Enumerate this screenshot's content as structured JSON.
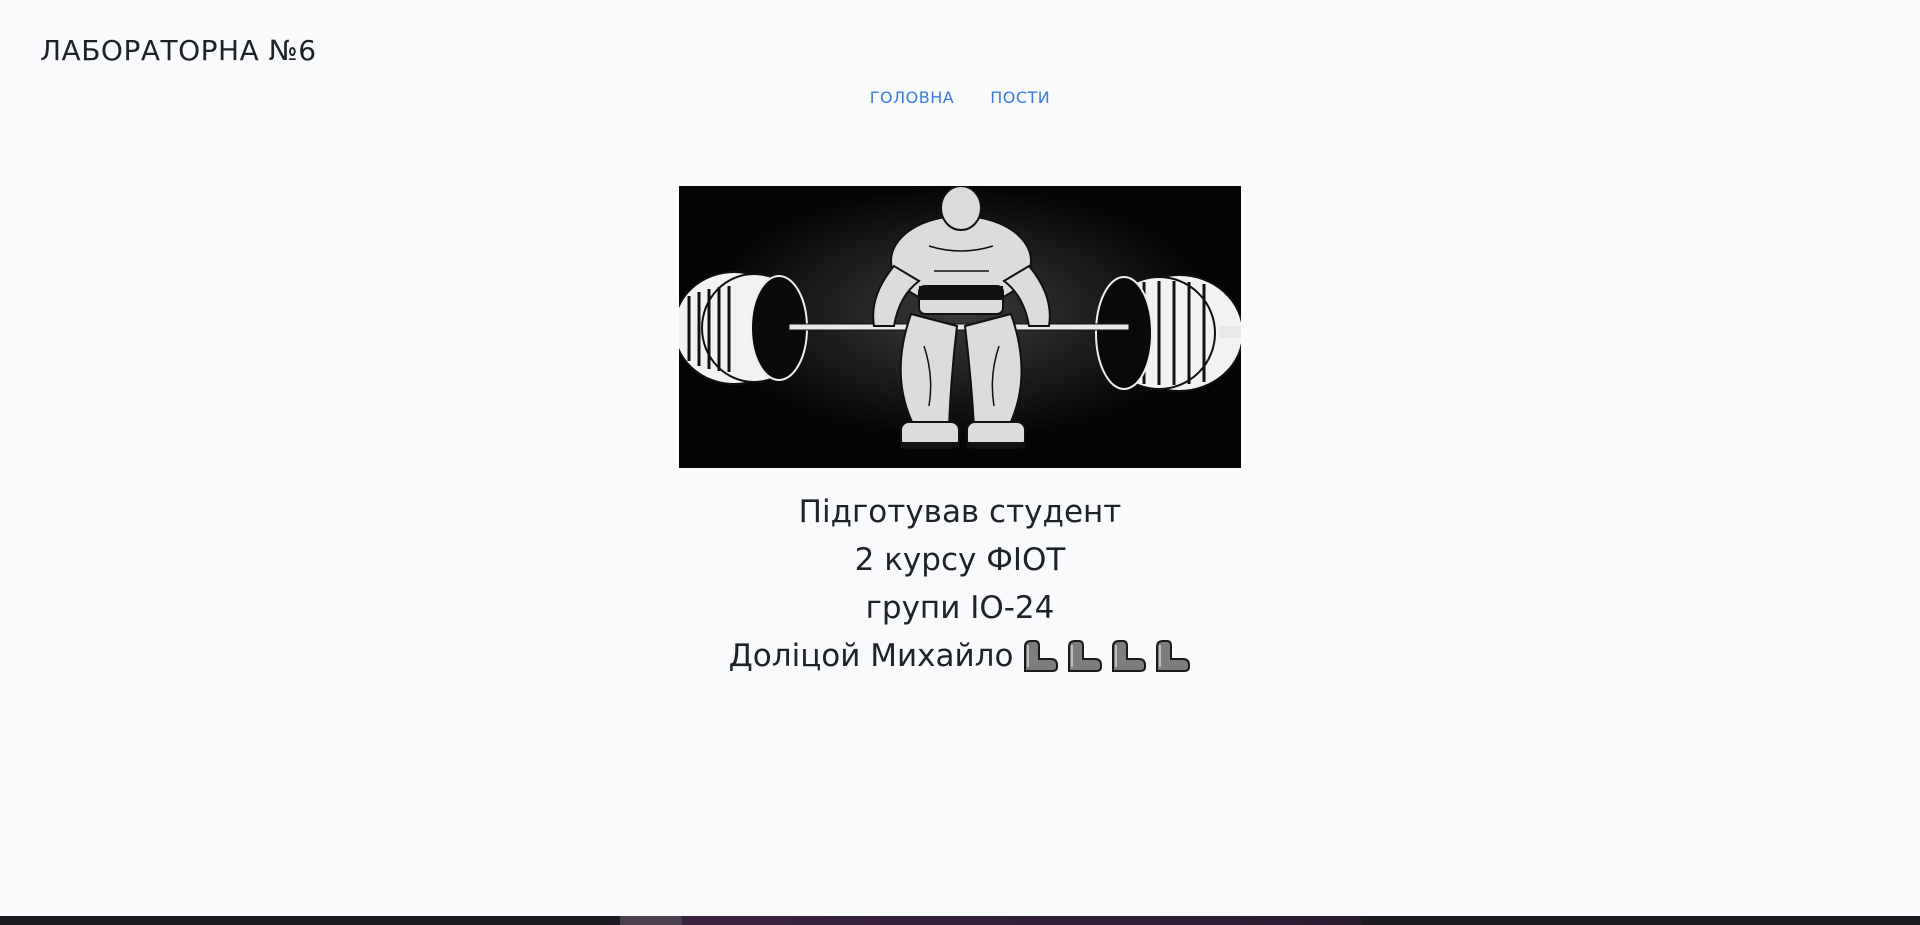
{
  "header": {
    "title": "ЛАБОРАТОРНА №6"
  },
  "nav": {
    "items": [
      {
        "label": "ГОЛОВНА"
      },
      {
        "label": "ПОСТИ"
      }
    ]
  },
  "hero": {
    "icon": "bodybuilder-deadlift-illustration"
  },
  "caption": {
    "lines": [
      "Підготував студент",
      "2 курсу ФІОТ",
      "групи ІО-24",
      "Доліцой Михайло"
    ],
    "emoji_icon": "flexed-arm-icon",
    "emoji_count": 4
  },
  "colors": {
    "background": "#f8fafc",
    "link": "#3b7be0",
    "text": "#1f2328"
  }
}
